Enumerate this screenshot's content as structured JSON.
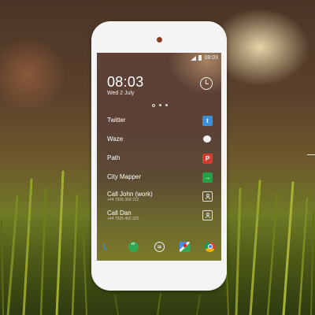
{
  "status_bar": {
    "time": "08:03",
    "signal_icon": "signal-icon",
    "battery_icon": "battery-icon"
  },
  "home": {
    "time": "08:03",
    "date": "Wed 2 July",
    "clock_icon": "clock-icon"
  },
  "pager": {
    "pages": 3,
    "current": 1
  },
  "shortcuts": [
    {
      "label": "Twitter",
      "icon": "twitter-icon",
      "glyph": "t"
    },
    {
      "label": "Waze",
      "icon": "waze-icon"
    },
    {
      "label": "Path",
      "icon": "path-icon",
      "glyph": "P"
    },
    {
      "label": "City Mapper",
      "icon": "city-mapper-icon",
      "glyph": "→"
    },
    {
      "label": "Call John (work)",
      "sub": "+44 7935 368 312",
      "icon": "contact-icon"
    },
    {
      "label": "Call Dan",
      "sub": "+44 7935 465 325",
      "icon": "contact-icon"
    }
  ],
  "dock": [
    "phone-icon",
    "hangouts-icon",
    "messages-icon",
    "maps-icon",
    "chrome-icon"
  ],
  "colors": {
    "twitter": "#3a8fd8",
    "path": "#d43b2e",
    "city_mapper": "#26a045",
    "phone_frame": "#f4f4f4"
  }
}
